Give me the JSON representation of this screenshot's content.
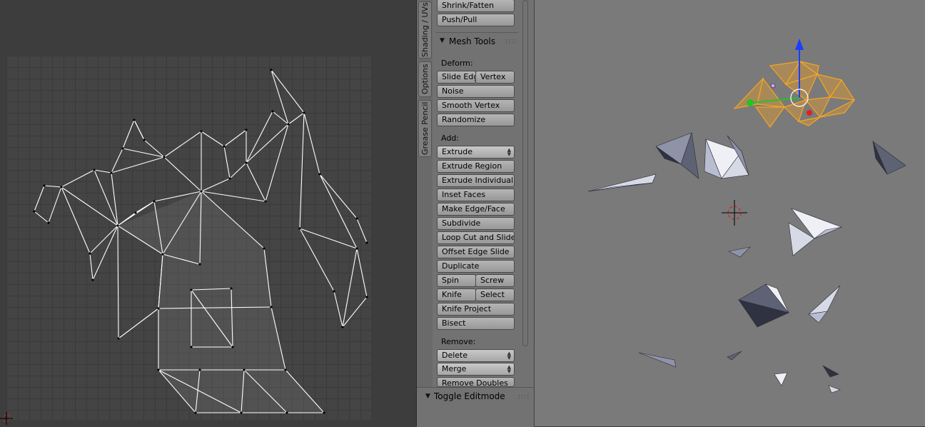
{
  "shelf": {
    "tabs": [
      "Shading / UVs",
      "Options",
      "Grease Pencil"
    ],
    "top_buttons": [
      "Shrink/Fatten",
      "Push/Pull"
    ],
    "mesh_tools_title": "Mesh Tools",
    "deform": {
      "label": "Deform:",
      "slide_edge": "Slide Edg",
      "vertex": "Vertex",
      "noise": "Noise",
      "smooth_vertex": "Smooth Vertex",
      "randomize": "Randomize"
    },
    "add": {
      "label": "Add:",
      "extrude": "Extrude",
      "extrude_region": "Extrude Region",
      "extrude_individual": "Extrude Individual",
      "inset_faces": "Inset Faces",
      "make_edge_face": "Make Edge/Face",
      "subdivide": "Subdivide",
      "loop_cut": "Loop Cut and Slide",
      "offset_edge_slide": "Offset Edge Slide",
      "duplicate": "Duplicate",
      "spin": "Spin",
      "screw": "Screw",
      "knife": "Knife",
      "select": "Select",
      "knife_project": "Knife Project",
      "bisect": "Bisect"
    },
    "remove": {
      "label": "Remove:",
      "delete": "Delete",
      "merge": "Merge",
      "remove_doubles": "Remove Doubles"
    },
    "toggle_editmode": "Toggle Editmode"
  },
  "colors": {
    "selection": "#f5a623",
    "mesh": "#b9bdd1",
    "uv_edge": "#ffffff",
    "axis_z": "#1a3dff",
    "axis_y": "#22c422",
    "axis_x": "#e22020"
  },
  "icons": [
    "cursor-3d-icon",
    "uv-cursor-icon",
    "transform-gizmo-icon"
  ]
}
